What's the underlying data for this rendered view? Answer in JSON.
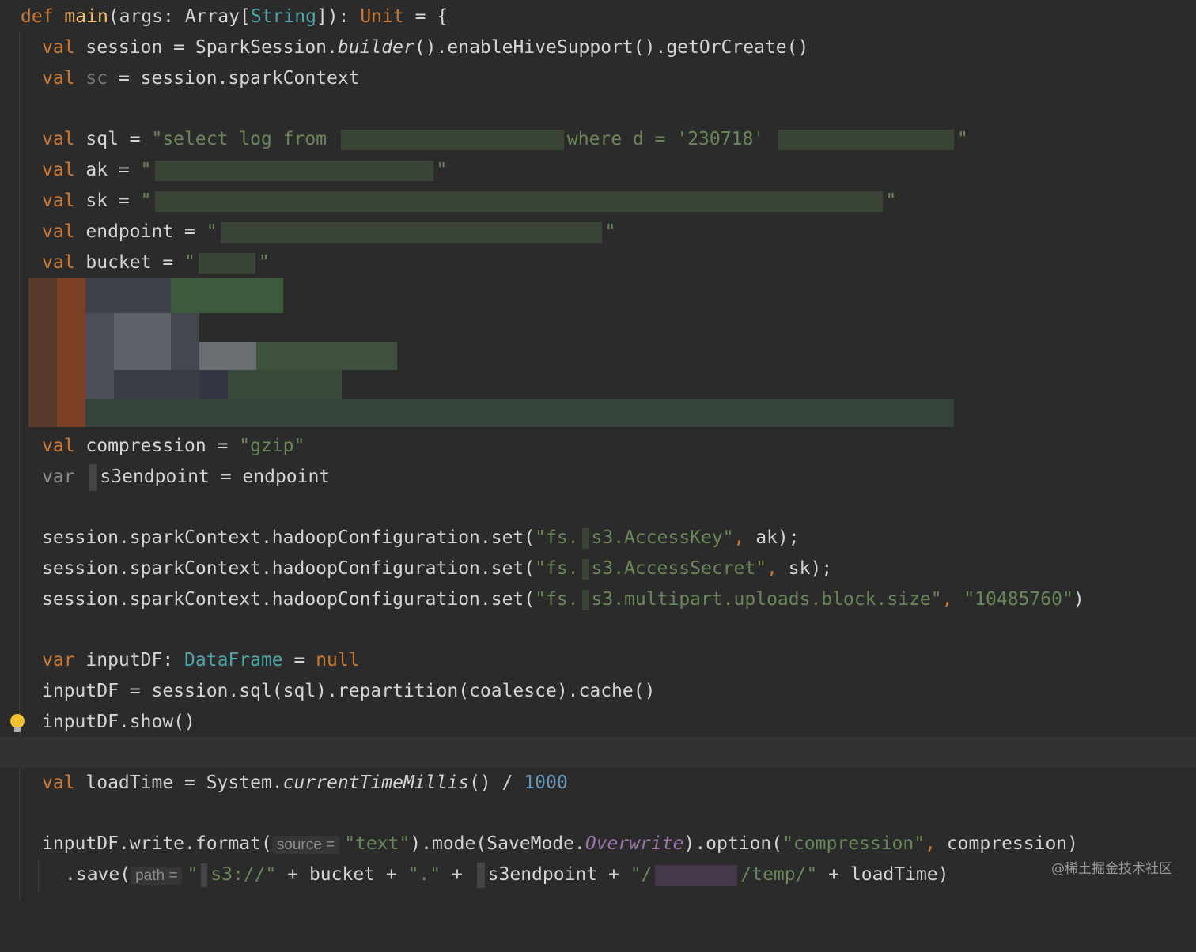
{
  "editor": {
    "lines": {
      "l1": {
        "kw": "def",
        "name": "main",
        "p1": "(args: ",
        "arr": "Array",
        "lb": "[",
        "tparam": "String",
        "rb": "]): ",
        "unit": "Unit",
        "rest": " = {"
      },
      "l2": {
        "kw": "val",
        "rest1": " session = SparkSession.",
        "builder": "builder",
        "rest2": "().enableHiveSupport().getOrCreate()"
      },
      "l3": {
        "kw": "val",
        "var": "sc",
        "rest": " = session.sparkContext"
      },
      "l5": {
        "kw": "val",
        "rest": " sql = ",
        "s1": "\"select log from ",
        "s2": "where d = '230718' ",
        "s3": "\""
      },
      "l6": {
        "kw": "val",
        "rest": " ak = ",
        "s1": "\"",
        "s2": "\""
      },
      "l7": {
        "kw": "val",
        "rest": " sk = ",
        "s1": "\"",
        "s2": "\""
      },
      "l8": {
        "kw": "val",
        "rest": " endpoint = ",
        "s1": "\"",
        "s2": "\""
      },
      "l9": {
        "kw": "val",
        "rest": " bucket = ",
        "s1": "\"",
        "s2": "\""
      },
      "l15": {
        "kw": "val",
        "rest": " compression = ",
        "s": "\"gzip\""
      },
      "l16": {
        "kw": "var",
        "rest": "s3endpoint = endpoint"
      },
      "l18": {
        "p": "session.sparkContext.hadoopConfiguration.set(",
        "s1": "\"fs.",
        "s2": "s3.AccessKey\"",
        "comma": ", ",
        "rest": "ak);"
      },
      "l19": {
        "p": "session.sparkContext.hadoopConfiguration.set(",
        "s1": "\"fs.",
        "s2": "s3.AccessSecret\"",
        "comma": ", ",
        "rest": "sk);"
      },
      "l20": {
        "p": "session.sparkContext.hadoopConfiguration.set(",
        "s1": "\"fs.",
        "s2": "s3.multipart.uploads.block.size\"",
        "comma": ", ",
        "s3": "\"10485760\"",
        "rest": ")"
      },
      "l22": {
        "kw": "var",
        "rest": " inputDF: ",
        "type": "DataFrame",
        "eq": " = ",
        "null": "null"
      },
      "l23": {
        "text": "inputDF = session.sql(sql).repartition(coalesce).cache()"
      },
      "l24": {
        "text": "inputDF.show()"
      },
      "l26": {
        "kw": "val",
        "rest": " loadTime = System.",
        "method": "currentTimeMillis",
        "p": "() / ",
        "num": "1000"
      },
      "l28": {
        "p1": "inputDF.write.format(",
        "hint": "source =",
        "s": "\"text\"",
        "p2": ").mode(SaveMode.",
        "ow": "Overwrite",
        "p3": ").option(",
        "s2": "\"compression\"",
        "comma": ", ",
        "p4": "compression)"
      },
      "l29": {
        "p1": ".save(",
        "hint": "path =",
        "s1": "\"",
        "s1b": "s3://\"",
        "p2": " + bucket + ",
        "s2": "\".\"",
        "p3": " + ",
        "p4": "s3endpoint + ",
        "s3": "\"/",
        "s4": "/temp/\"",
        "p5": " + loadTime)"
      }
    }
  },
  "watermark": "@稀土掘金技术社区",
  "colors": {
    "background": "#2b2b2b",
    "keyword": "#cc7832",
    "string": "#6a8759",
    "number": "#6897bb",
    "function": "#ffc66d",
    "type": "#4ea5a8",
    "static_member": "#9876aa"
  },
  "icons": {
    "gutter": "lightbulb-icon"
  }
}
